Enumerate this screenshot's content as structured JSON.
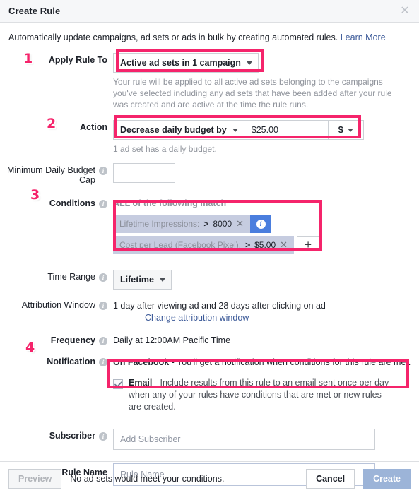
{
  "window": {
    "title": "Create Rule",
    "close_icon": "close-icon"
  },
  "intro": {
    "text": "Automatically update campaigns, ad sets or ads in bulk by creating automated rules.",
    "link": "Learn More"
  },
  "markers": {
    "one": "1",
    "two": "2",
    "three": "3",
    "four": "4"
  },
  "apply_rule_to": {
    "label": "Apply Rule To",
    "selected": "Active ad sets in 1 campaign",
    "help": "Your rule will be applied to all active ad sets belonging to the campaigns you've selected including any ad sets that have been added after your rule was created and are active at the time the rule runs."
  },
  "action": {
    "label": "Action",
    "selected": "Decrease daily budget by",
    "value": "$25.00",
    "currency": "$",
    "help": "1 ad set has a daily budget."
  },
  "min_budget_cap": {
    "label": "Minimum Daily Budget Cap",
    "value": ""
  },
  "conditions": {
    "label": "Conditions",
    "match_text": "ALL of the following match",
    "items": [
      {
        "name": "Lifetime Impressions:",
        "operator": ">",
        "value": "8000",
        "remove_icon": "close-icon",
        "has_info": true
      },
      {
        "name": "Cost per Lead (Facebook Pixel):",
        "operator": ">",
        "value": "$5.00",
        "remove_icon": "close-icon",
        "has_info": false
      }
    ],
    "add_label": "+"
  },
  "time_range": {
    "label": "Time Range",
    "selected": "Lifetime"
  },
  "attribution": {
    "label": "Attribution Window",
    "value": "1 day after viewing ad and 28 days after clicking on ad",
    "link": "Change attribution window"
  },
  "frequency": {
    "label": "Frequency",
    "value": "Daily at 12:00AM Pacific Time"
  },
  "notification": {
    "label": "Notification",
    "on_facebook_bold": "On Facebook",
    "on_facebook_rest": " - You'll get a notification when conditions for this rule are met.",
    "email_checked": true,
    "email_bold": "Email",
    "email_rest": " - Include results from this rule to an email sent once per day when any of your rules have conditions that are met or new rules are created."
  },
  "subscriber": {
    "label": "Subscriber",
    "placeholder": "Add Subscriber",
    "value": ""
  },
  "rule_name": {
    "label": "Rule Name",
    "placeholder": "Rule Name",
    "value": ""
  },
  "footer": {
    "preview_label": "Preview",
    "note": "No ad sets would meet your conditions.",
    "cancel_label": "Cancel",
    "create_label": "Create"
  },
  "colors": {
    "accent_pink": "#f5246b",
    "link_blue": "#3b5998",
    "pill_blue": "#4a7ede",
    "pill_bg": "#c6cce0"
  }
}
